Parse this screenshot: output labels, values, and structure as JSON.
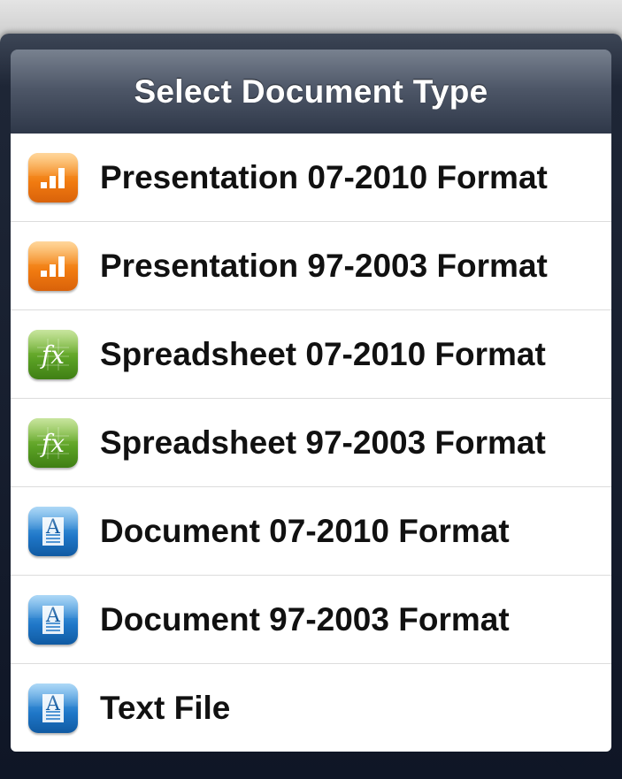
{
  "dialog": {
    "title": "Select Document Type"
  },
  "items": [
    {
      "label": "Presentation 07-2010 Format",
      "icon": "presentation-icon"
    },
    {
      "label": "Presentation 97-2003 Format",
      "icon": "presentation-icon"
    },
    {
      "label": "Spreadsheet 07-2010 Format",
      "icon": "spreadsheet-icon"
    },
    {
      "label": "Spreadsheet 97-2003 Format",
      "icon": "spreadsheet-icon"
    },
    {
      "label": "Document 07-2010 Format",
      "icon": "document-icon"
    },
    {
      "label": "Document 97-2003 Format",
      "icon": "document-icon"
    },
    {
      "label": "Text File",
      "icon": "document-icon"
    }
  ],
  "colors": {
    "presentation": "#f07a10",
    "spreadsheet": "#5aa024",
    "document": "#1f77c8",
    "header": "#4d5667"
  }
}
